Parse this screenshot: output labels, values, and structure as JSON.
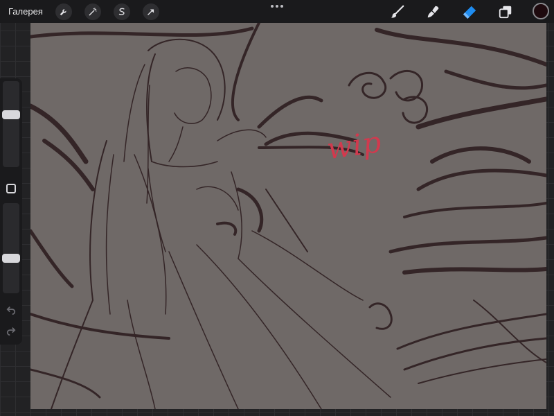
{
  "topbar": {
    "gallery_label": "Галерея",
    "left_tools": [
      "wrench-icon",
      "magic-wand-icon",
      "selection-icon",
      "transform-arrow-icon"
    ],
    "right_tools": [
      "brush-icon",
      "smudge-icon",
      "eraser-icon",
      "layers-icon"
    ],
    "active_tool": "eraser-icon",
    "active_tool_color": "#1e8cf0",
    "current_color": "#1e0a0e"
  },
  "canvas": {
    "background_color": "#6f6967",
    "stroke_color": "#2a1a1c",
    "annotation_text": "wip",
    "annotation_color": "#d13a4e"
  },
  "sidebar": {
    "brush_size_level": 0.62,
    "opacity_level": 0.38,
    "tools": [
      "modify-square-icon",
      "undo-icon",
      "redo-icon"
    ]
  }
}
